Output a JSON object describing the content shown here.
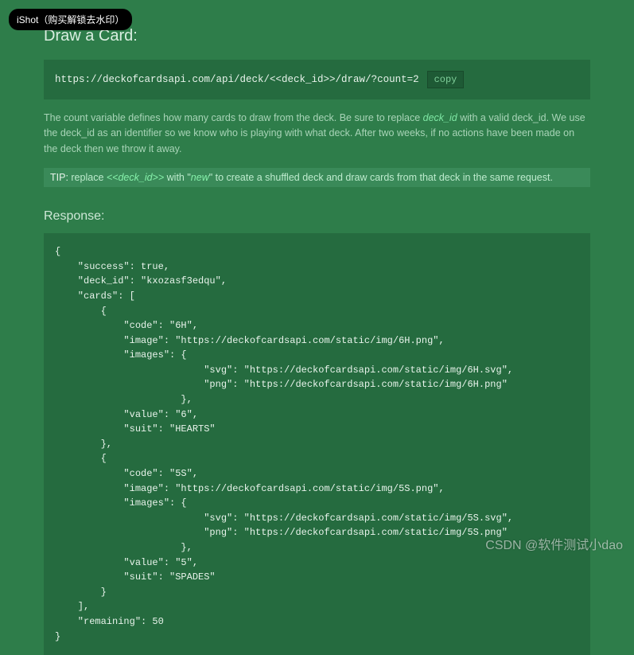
{
  "watermark_badge": "iShot（购买解锁去水印）",
  "title": "Draw a Card:",
  "url_box": {
    "url": "https://deckofcardsapi.com/api/deck/<<deck_id>>/draw/?count=2",
    "copy_label": "copy"
  },
  "description": {
    "pre": "The count variable defines how many cards to draw from the deck. Be sure to replace ",
    "highlight": "deck_id",
    "post": " with a valid deck_id. We use the deck_id as an identifier so we know who is playing with what deck. After two weeks, if no actions have been made on the deck then we throw it away."
  },
  "tip": {
    "label": "TIP:",
    "pre": " replace ",
    "hl1": "<<deck_id>>",
    "mid": " with \"",
    "hl2": "new",
    "post": "\" to create a shuffled deck and draw cards from that deck in the same request."
  },
  "response_heading": "Response:",
  "response_body": "{\n    \"success\": true,\n    \"deck_id\": \"kxozasf3edqu\",\n    \"cards\": [\n        {\n            \"code\": \"6H\",\n            \"image\": \"https://deckofcardsapi.com/static/img/6H.png\",\n            \"images\": {\n                          \"svg\": \"https://deckofcardsapi.com/static/img/6H.svg\",\n                          \"png\": \"https://deckofcardsapi.com/static/img/6H.png\"\n                      },\n            \"value\": \"6\",\n            \"suit\": \"HEARTS\"\n        },\n        {\n            \"code\": \"5S\",\n            \"image\": \"https://deckofcardsapi.com/static/img/5S.png\",\n            \"images\": {\n                          \"svg\": \"https://deckofcardsapi.com/static/img/5S.svg\",\n                          \"png\": \"https://deckofcardsapi.com/static/img/5S.png\"\n                      },\n            \"value\": \"5\",\n            \"suit\": \"SPADES\"\n        }\n    ],\n    \"remaining\": 50\n}",
  "footer_watermark": "CSDN @软件测试小dao"
}
